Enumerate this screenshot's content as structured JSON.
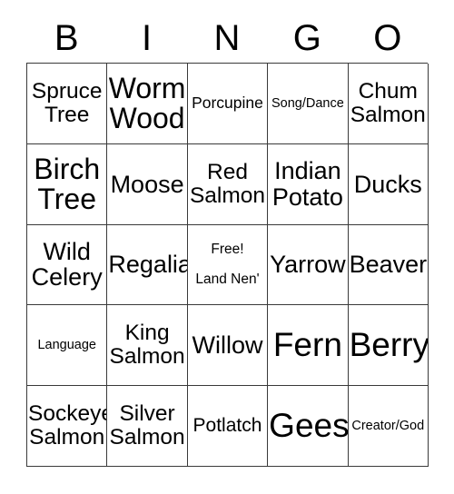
{
  "card": {
    "header_letters": [
      "B",
      "I",
      "N",
      "G",
      "O"
    ],
    "rows": [
      [
        {
          "text": "Spruce Tree",
          "size": "l"
        },
        {
          "text": "Worm Wood",
          "size": "xxl"
        },
        {
          "text": "Porcupine",
          "size": "s"
        },
        {
          "text": "Song/Dance",
          "size": "xs"
        },
        {
          "text": "Chum Salmon",
          "size": "l"
        }
      ],
      [
        {
          "text": "Birch Tree",
          "size": "xxl"
        },
        {
          "text": "Moose",
          "size": "xl"
        },
        {
          "text": "Red Salmon",
          "size": "l"
        },
        {
          "text": "Indian Potato",
          "size": "xl"
        },
        {
          "text": "Ducks",
          "size": "xl"
        }
      ],
      [
        {
          "text": "Wild Celery",
          "size": "xl"
        },
        {
          "text": "Regalia",
          "size": "xl"
        },
        {
          "free": true,
          "line1": "Free!",
          "line2": "Land Nen'"
        },
        {
          "text": "Yarrow",
          "size": "xl"
        },
        {
          "text": "Beaver",
          "size": "xl"
        }
      ],
      [
        {
          "text": "Language",
          "size": "xs"
        },
        {
          "text": "King Salmon",
          "size": "l"
        },
        {
          "text": "Willow",
          "size": "xl"
        },
        {
          "text": "Fern",
          "size": "xxxl"
        },
        {
          "text": "Berry",
          "size": "xxxl"
        }
      ],
      [
        {
          "text": "Sockeye Salmon",
          "size": "l"
        },
        {
          "text": "Silver Salmon",
          "size": "l"
        },
        {
          "text": "Potlatch",
          "size": "m"
        },
        {
          "text": "Geese",
          "size": "xxxl"
        },
        {
          "text": "Creator/God",
          "size": "xs"
        }
      ]
    ]
  },
  "colors": {
    "background": "#ffffff",
    "grid_line": "#3a3a3a",
    "text": "#000000"
  }
}
